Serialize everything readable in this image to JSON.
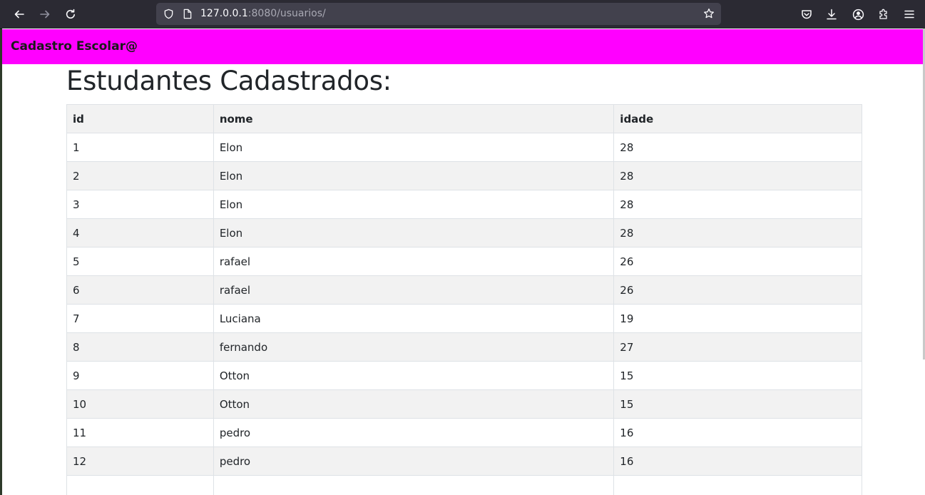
{
  "browser": {
    "url_host": "127.0.0.1",
    "url_rest": ":8080/usuarios/"
  },
  "site": {
    "brand": "Cadastro Escolar@",
    "nav_color": "#ff00ff"
  },
  "page": {
    "title": "Estudantes Cadastrados:"
  },
  "table": {
    "headers": [
      "id",
      "nome",
      "idade"
    ],
    "rows": [
      [
        "1",
        "Elon",
        "28"
      ],
      [
        "2",
        "Elon",
        "28"
      ],
      [
        "3",
        "Elon",
        "28"
      ],
      [
        "4",
        "Elon",
        "28"
      ],
      [
        "5",
        "rafael",
        "26"
      ],
      [
        "6",
        "rafael",
        "26"
      ],
      [
        "7",
        "Luciana",
        "19"
      ],
      [
        "8",
        "fernando",
        "27"
      ],
      [
        "9",
        "Otton",
        "15"
      ],
      [
        "10",
        "Otton",
        "15"
      ],
      [
        "11",
        "pedro",
        "16"
      ],
      [
        "12",
        "pedro",
        "16"
      ]
    ]
  },
  "icons": {
    "back": "arrow-left-icon",
    "forward": "arrow-right-icon",
    "reload": "reload-icon",
    "shield": "shield-icon",
    "page": "page-icon",
    "bookmark": "star-icon",
    "pocket": "pocket-icon",
    "downloads": "download-icon",
    "account": "account-icon",
    "extensions": "puzzle-icon",
    "menu": "hamburger-menu-icon"
  }
}
